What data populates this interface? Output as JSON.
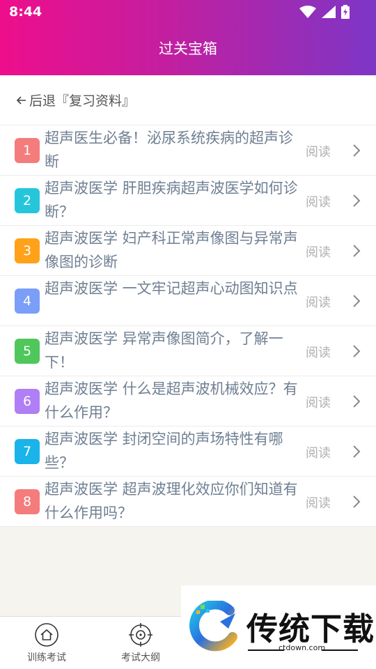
{
  "status_bar": {
    "time": "8:44"
  },
  "header": {
    "title": "过关宝箱"
  },
  "back": {
    "label": "后退『复习资料』"
  },
  "read_label": "阅读",
  "items": [
    {
      "num": "1",
      "title": "超声医生必备！泌尿系统疾病的超声诊断",
      "color": "#f47c7c"
    },
    {
      "num": "2",
      "title": "超声波医学 肝胆疾病超声波医学如何诊断？",
      "color": "#26c6da"
    },
    {
      "num": "3",
      "title": "超声波医学 妇产科正常声像图与异常声像图的诊断",
      "color": "#ffa21a"
    },
    {
      "num": "4",
      "title": "超声波医学 一文牢记超声心动图知识点",
      "color": "#7b9ef8"
    },
    {
      "num": "5",
      "title": "超声波医学 异常声像图简介，了解一下！",
      "color": "#4fc75b"
    },
    {
      "num": "6",
      "title": "超声波医学 什么是超声波机械效应？有什么作用？",
      "color": "#b07ef5"
    },
    {
      "num": "7",
      "title": "超声波医学 封闭空间的声场特性有哪些？",
      "color": "#1ab3ea"
    },
    {
      "num": "8",
      "title": "超声波医学 超声波理化效应你们知道有什么作用吗？",
      "color": "#f47c7c"
    }
  ],
  "bottom_nav": {
    "tab1": {
      "label": "训练考试",
      "icon": "home-icon"
    },
    "tab2": {
      "label": "考试大纲",
      "icon": "target-icon"
    }
  },
  "watermark": {
    "brand": "传统下载",
    "url": "ctdown.com"
  }
}
